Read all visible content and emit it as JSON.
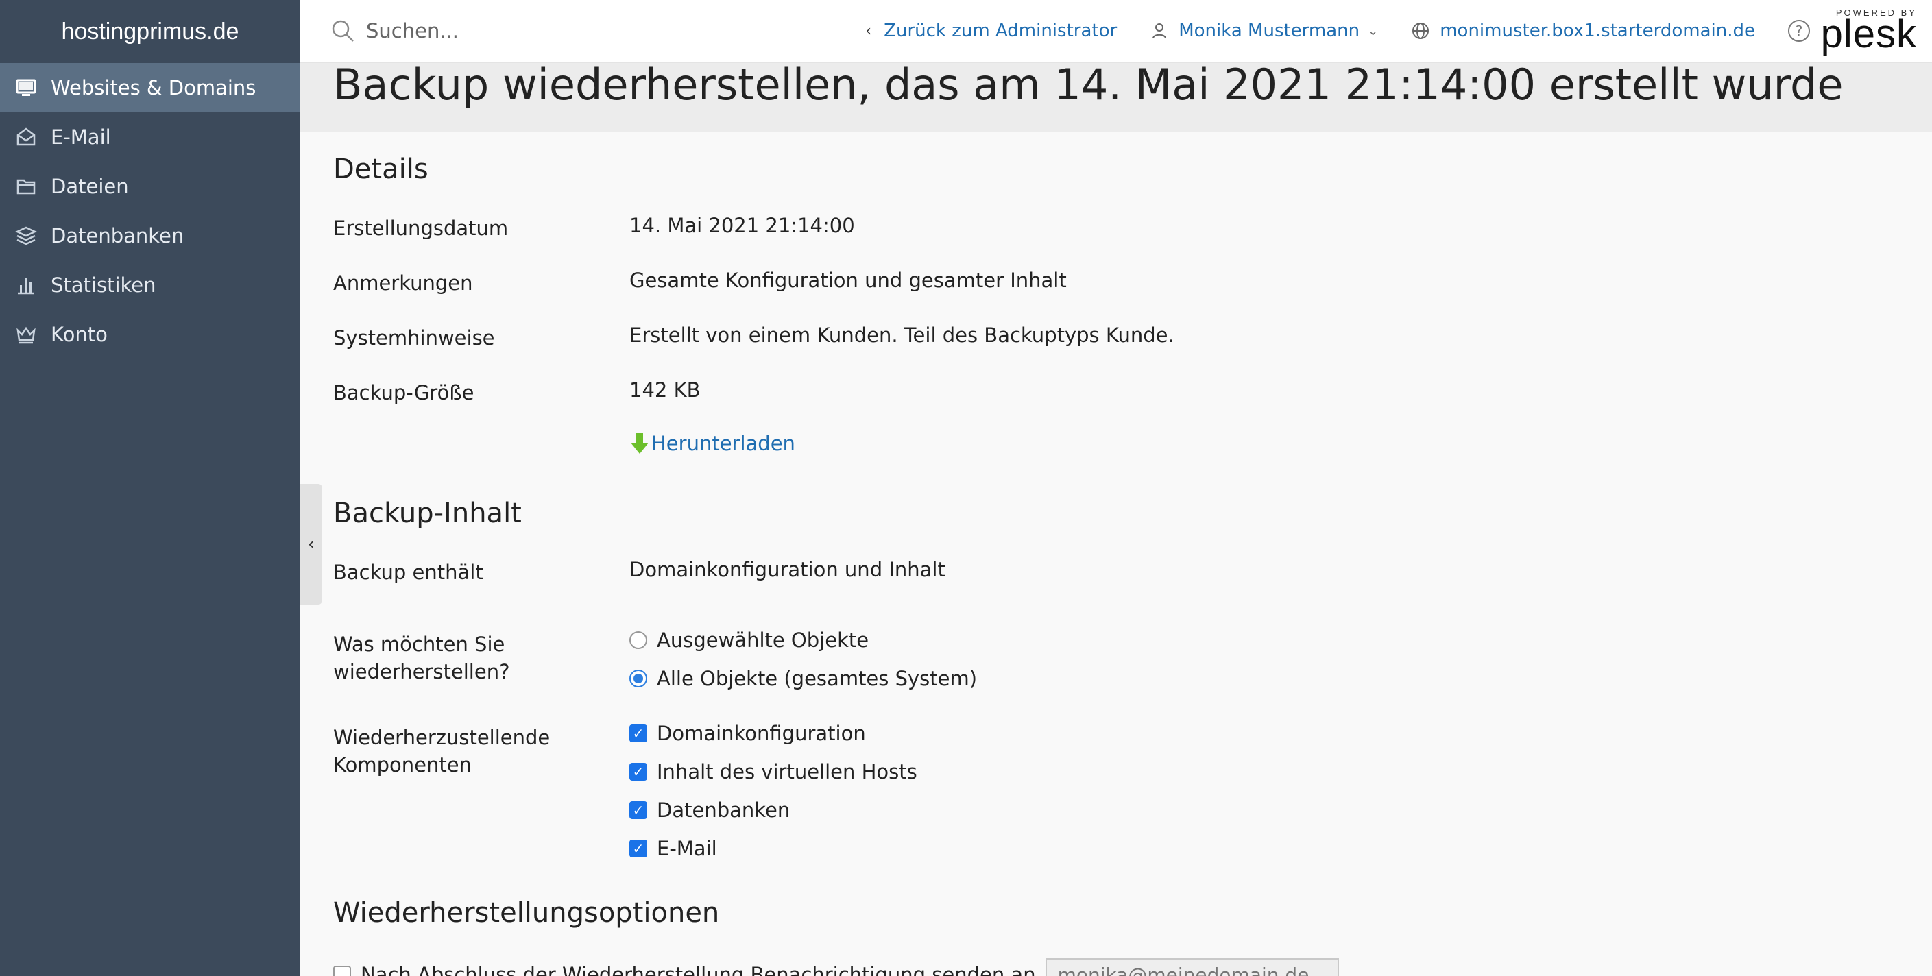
{
  "brand": "hostingprimus.de",
  "sidebar": {
    "items": [
      {
        "label": "Websites & Domains",
        "icon": "monitor-icon",
        "active": true
      },
      {
        "label": "E-Mail",
        "icon": "mail-icon"
      },
      {
        "label": "Dateien",
        "icon": "folder-icon"
      },
      {
        "label": "Datenbanken",
        "icon": "database-icon"
      },
      {
        "label": "Statistiken",
        "icon": "bar-chart-icon"
      },
      {
        "label": "Konto",
        "icon": "crown-icon"
      }
    ]
  },
  "topbar": {
    "search_placeholder": "Suchen...",
    "back_label": "Zurück zum Administrator",
    "user_label": "Monika Mustermann",
    "domain_label": "monimuster.box1.starterdomain.de",
    "help_label": "?",
    "powered_by": "POWERED BY",
    "plesk": "plesk"
  },
  "page": {
    "title": "Backup wiederherstellen, das am 14. Mai 2021 21:14:00 erstellt wurde"
  },
  "details": {
    "heading": "Details",
    "rows": [
      {
        "label": "Erstellungsdatum",
        "value": "14. Mai 2021 21:14:00"
      },
      {
        "label": "Anmerkungen",
        "value": "Gesamte Konfiguration und gesamter Inhalt"
      },
      {
        "label": "Systemhinweise",
        "value": "Erstellt von einem Kunden. Teil des Backuptyps Kunde."
      },
      {
        "label": "Backup-Größe",
        "value": "142 KB"
      }
    ],
    "download_label": "Herunterladen"
  },
  "content": {
    "heading": "Backup-Inhalt",
    "contains_label": "Backup enthält",
    "contains_value": "Domainkonfiguration und Inhalt",
    "restore_label_1": "Was möchten Sie",
    "restore_label_2": "wiederherstellen?",
    "radio_options": [
      {
        "label": "Ausgewählte Objekte",
        "selected": false
      },
      {
        "label": "Alle Objekte (gesamtes System)",
        "selected": true
      }
    ],
    "components_label_1": "Wiederherzustellende",
    "components_label_2": "Komponenten",
    "components": [
      {
        "label": "Domainkonfiguration",
        "checked": true
      },
      {
        "label": "Inhalt des virtuellen Hosts",
        "checked": true
      },
      {
        "label": "Datenbanken",
        "checked": true
      },
      {
        "label": "E-Mail",
        "checked": true
      }
    ]
  },
  "options": {
    "heading": "Wiederherstellungsoptionen",
    "notify_label": "Nach Abschluss der Wiederherstellung Benachrichtigung senden an",
    "notify_checked": false,
    "email_placeholder": "monika@meinedomain.de"
  },
  "colors": {
    "sidebar_bg": "#3c4a5b",
    "sidebar_active": "#5b6f84",
    "link": "#1f6db1",
    "checkbox": "#1a73e8",
    "download_arrow": "#6cbf2b"
  }
}
